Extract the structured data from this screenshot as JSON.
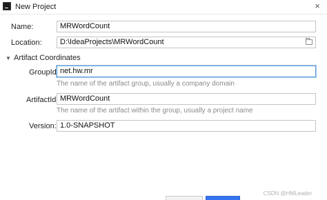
{
  "window": {
    "title": "New Project",
    "close_glyph": "×"
  },
  "form": {
    "name": {
      "label": "Name:",
      "value": "MRWordCount"
    },
    "location": {
      "label": "Location:",
      "value": "D:\\IdeaProjects\\MRWordCount"
    },
    "artifact_section": {
      "title": "Artifact Coordinates",
      "expanded_glyph": "▼"
    },
    "group_id": {
      "label": "GroupId:",
      "value": "net.hw.mr",
      "hint": "The name of the artifact group, usually a company domain"
    },
    "artifact_id": {
      "label": "ArtifactId:",
      "value": "MRWordCount",
      "hint": "The name of the artifact within the group, usually a project name"
    },
    "version": {
      "label": "Version:",
      "value": "1.0-SNAPSHOT"
    }
  },
  "watermark": "CSDN @HMLeader",
  "icons": {
    "app": "intellij-app-icon",
    "folder": "folder-icon",
    "close": "close-icon"
  }
}
